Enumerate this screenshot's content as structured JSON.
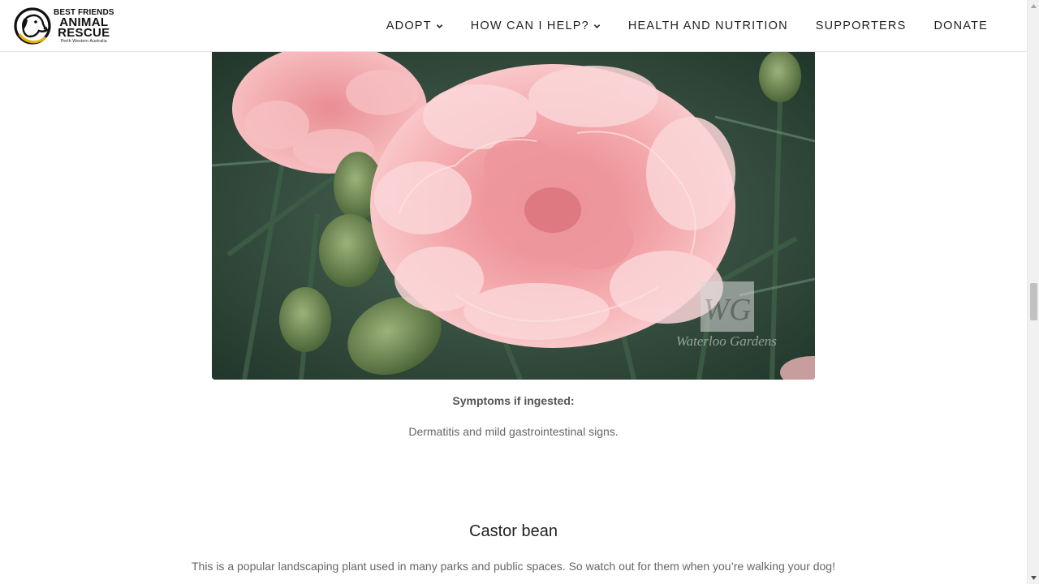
{
  "header": {
    "logo": {
      "line1": "BEST FRIENDS",
      "line2": "ANIMAL",
      "line3": "RESCUE",
      "line4": "Perth Western Australia"
    },
    "nav": [
      {
        "label": "ADOPT",
        "has_dropdown": true
      },
      {
        "label": "HOW CAN I HELP?",
        "has_dropdown": true
      },
      {
        "label": "HEALTH AND NUTRITION",
        "has_dropdown": false
      },
      {
        "label": "SUPPORTERS",
        "has_dropdown": false
      },
      {
        "label": "DONATE",
        "has_dropdown": false
      }
    ]
  },
  "main": {
    "image": {
      "watermark_monogram": "WG",
      "watermark_text": "Waterloo Gardens"
    },
    "symptoms_label": "Symptoms if ingested:",
    "symptoms_text": "Dermatitis and mild gastrointestinal signs.",
    "next_section": {
      "title": "Castor bean",
      "text": "This is a popular landscaping plant used in many parks and public spaces. So watch out for them when you’re walking your dog!"
    }
  },
  "colors": {
    "accent": "#222222",
    "body_text": "#666666",
    "logo_ring": "#e8b400"
  },
  "icons": [
    "dog-logo-icon",
    "chevron-down-icon",
    "scroll-up-icon",
    "scroll-down-icon"
  ]
}
